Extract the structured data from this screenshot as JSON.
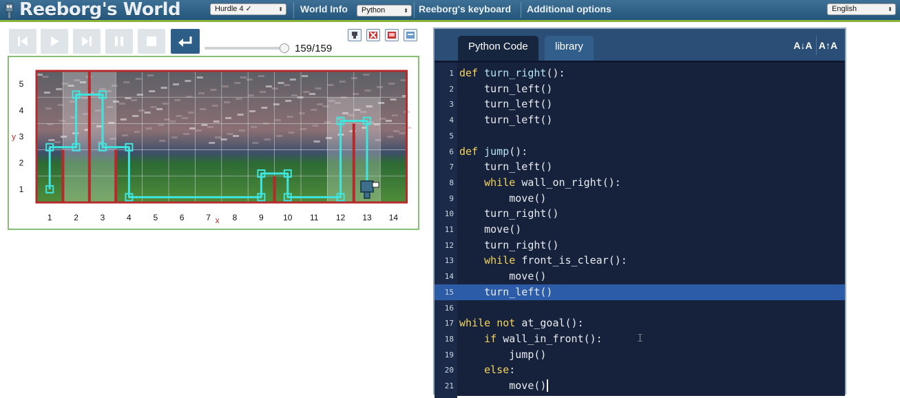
{
  "header": {
    "title": "Reeborg's World",
    "world_select": "Hurdle 4 ✓",
    "world_info": "World Info",
    "language_select": "Python",
    "keyboard": "Reeborg's keyboard",
    "additional_options": "Additional options",
    "ui_language_select": "English",
    "colors": {
      "bar": "#2a5a80",
      "accent": "#8bb53a"
    }
  },
  "controls": {
    "buttons": [
      "reload-icon",
      "play-icon",
      "step-icon",
      "pause-icon",
      "stop-icon",
      "return-icon"
    ],
    "step_counter": "159/159",
    "step_progress": 1.0,
    "world_buttons": [
      "robot-icon",
      "delete-world-icon",
      "flag-icon",
      "edit-world-icon"
    ]
  },
  "world": {
    "x_ticks": [
      "1",
      "2",
      "3",
      "4",
      "5",
      "6",
      "7",
      "8",
      "9",
      "10",
      "11",
      "12",
      "13",
      "14"
    ],
    "y_ticks": [
      "1",
      "2",
      "3",
      "4",
      "5"
    ],
    "x_axis_label": "x",
    "y_axis_label": "y",
    "wall_color": "#b52a2a",
    "trace_color": "#3ee6e0"
  },
  "editor": {
    "tabs": [
      "Python Code",
      "library"
    ],
    "font_down": "A↓A",
    "font_up": "A↑A",
    "active_line": 15,
    "lines": [
      [
        {
          "t": "def ",
          "c": "kw"
        },
        {
          "t": "turn_right",
          "c": "fn"
        },
        {
          "t": "():",
          "c": ""
        }
      ],
      [
        {
          "t": "    turn_left()",
          "c": ""
        }
      ],
      [
        {
          "t": "    turn_left()",
          "c": ""
        }
      ],
      [
        {
          "t": "    turn_left()",
          "c": ""
        }
      ],
      [],
      [
        {
          "t": "def ",
          "c": "kw"
        },
        {
          "t": "jump",
          "c": "fn"
        },
        {
          "t": "():",
          "c": ""
        }
      ],
      [
        {
          "t": "    turn_left()",
          "c": ""
        }
      ],
      [
        {
          "t": "    ",
          "c": ""
        },
        {
          "t": "while ",
          "c": "kw"
        },
        {
          "t": "wall_on_right():",
          "c": ""
        }
      ],
      [
        {
          "t": "        move()",
          "c": ""
        }
      ],
      [
        {
          "t": "    turn_right()",
          "c": ""
        }
      ],
      [
        {
          "t": "    move()",
          "c": ""
        }
      ],
      [
        {
          "t": "    turn_right()",
          "c": ""
        }
      ],
      [
        {
          "t": "    ",
          "c": ""
        },
        {
          "t": "while ",
          "c": "kw"
        },
        {
          "t": "front_is_clear():",
          "c": ""
        }
      ],
      [
        {
          "t": "        move()",
          "c": ""
        }
      ],
      [
        {
          "t": "    turn_left()",
          "c": ""
        }
      ],
      [],
      [
        {
          "t": "while ",
          "c": "kw"
        },
        {
          "t": "not ",
          "c": "kw"
        },
        {
          "t": "at_goal():",
          "c": ""
        }
      ],
      [
        {
          "t": "    ",
          "c": ""
        },
        {
          "t": "if ",
          "c": "kw"
        },
        {
          "t": "wall_in_front():",
          "c": ""
        }
      ],
      [
        {
          "t": "        jump()",
          "c": ""
        }
      ],
      [
        {
          "t": "    ",
          "c": ""
        },
        {
          "t": "else",
          "c": "kw"
        },
        {
          "t": ":",
          "c": ""
        }
      ],
      [
        {
          "t": "        move()",
          "c": ""
        }
      ]
    ]
  }
}
